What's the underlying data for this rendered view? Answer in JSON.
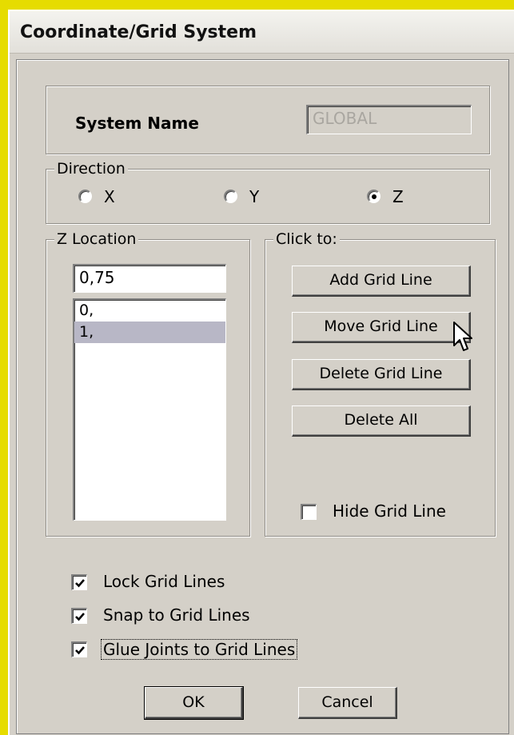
{
  "window": {
    "title": "Coordinate/Grid System"
  },
  "system_name": {
    "label": "System Name",
    "value": "GLOBAL"
  },
  "direction": {
    "legend": "Direction",
    "options": [
      {
        "label": "X",
        "selected": false
      },
      {
        "label": "Y",
        "selected": false
      },
      {
        "label": "Z",
        "selected": true
      }
    ]
  },
  "location": {
    "legend": "Z Location",
    "input_value": "0,75",
    "items": [
      {
        "label": "0,",
        "selected": false
      },
      {
        "label": "1,",
        "selected": true
      }
    ]
  },
  "click_to": {
    "legend": "Click to:",
    "add": "Add Grid Line",
    "move": "Move Grid Line",
    "delete": "Delete Grid Line",
    "delete_all": "Delete All",
    "hide": {
      "label": "Hide Grid Line",
      "checked": false
    }
  },
  "options": {
    "lock": {
      "label": "Lock Grid Lines",
      "checked": true
    },
    "snap": {
      "label": "Snap to Grid Lines",
      "checked": true
    },
    "glue": {
      "label": "Glue Joints to Grid Lines",
      "checked": true
    }
  },
  "buttons": {
    "ok": "OK",
    "cancel": "Cancel"
  },
  "colors": {
    "background": "#e6dc00",
    "dialog_face": "#d4d0c8",
    "list_selection": "#b8b7c6",
    "disabled_text": "#a9a6a0"
  }
}
